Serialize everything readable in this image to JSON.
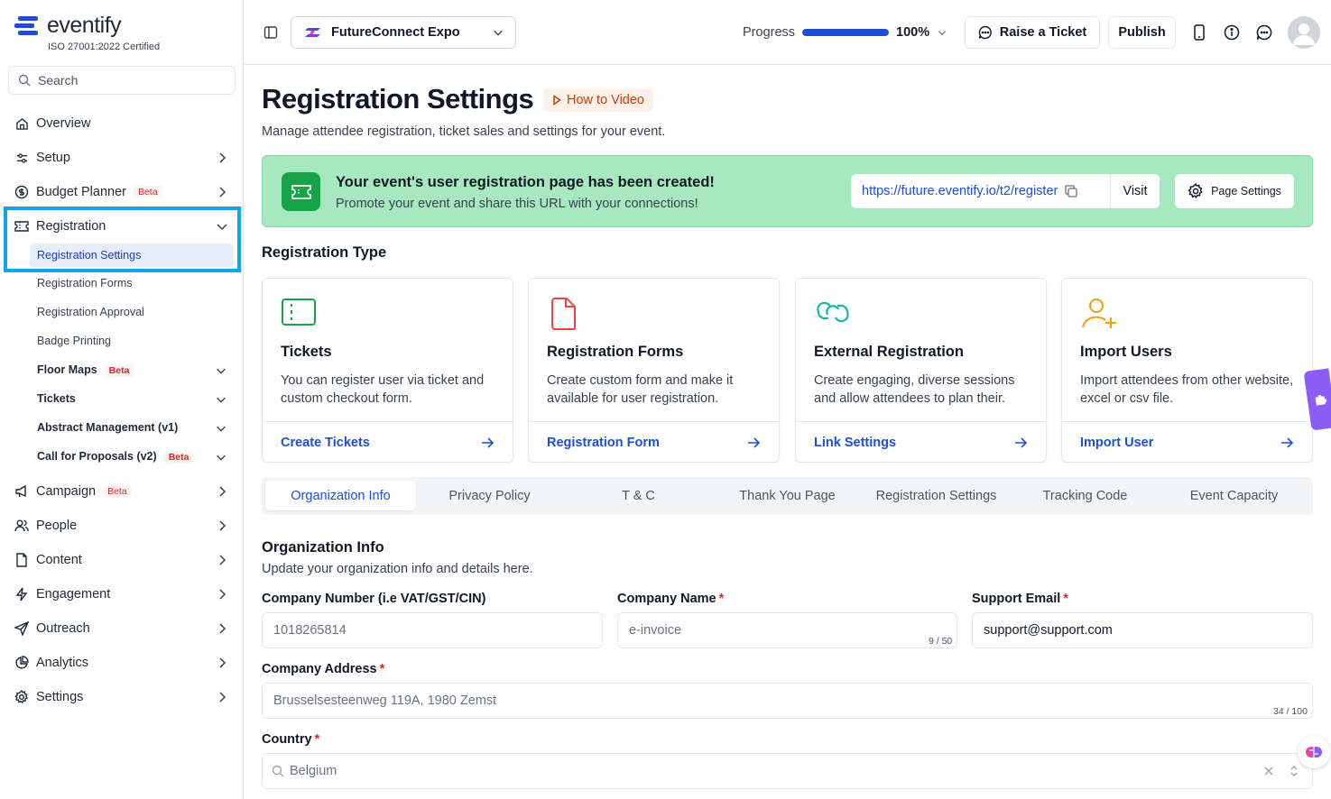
{
  "brand": {
    "name": "eventify",
    "cert": "ISO 27001:2022 Certified",
    "color": "#1d4ed8"
  },
  "sidebar": {
    "search_placeholder": "Search",
    "items": [
      {
        "label": "Overview"
      },
      {
        "label": "Setup"
      },
      {
        "label": "Budget Planner",
        "badge": "Beta"
      },
      {
        "label": "Registration"
      },
      {
        "label": "Campaign",
        "badge": "Beta"
      },
      {
        "label": "People"
      },
      {
        "label": "Content"
      },
      {
        "label": "Engagement"
      },
      {
        "label": "Outreach"
      },
      {
        "label": "Analytics"
      },
      {
        "label": "Settings"
      }
    ],
    "registration_sub": [
      {
        "label": "Registration Settings"
      },
      {
        "label": "Registration Forms"
      },
      {
        "label": "Registration Approval"
      },
      {
        "label": "Badge Printing"
      },
      {
        "label": "Floor Maps",
        "badge": "Beta"
      },
      {
        "label": "Tickets"
      },
      {
        "label": "Abstract Management (v1)"
      },
      {
        "label": "Call for Proposals (v2)",
        "badge": "Beta"
      }
    ]
  },
  "topbar": {
    "event_name": "FutureConnect Expo",
    "progress_label": "Progress",
    "progress_value": "100%",
    "progress_fraction": 1.0,
    "raise_ticket": "Raise a Ticket",
    "publish": "Publish"
  },
  "page": {
    "title": "Registration Settings",
    "how_to": "How to Video",
    "subtitle": "Manage attendee registration, ticket sales and settings for your event."
  },
  "banner": {
    "title": "Your event's user registration page has been created!",
    "subtitle": "Promote your event and share this URL with your connections!",
    "url": "https://future.eventify.io/t2/register",
    "visit": "Visit",
    "page_settings": "Page Settings"
  },
  "registration_type": {
    "title": "Registration Type",
    "cards": [
      {
        "title": "Tickets",
        "desc": "You can register user via ticket and custom checkout form.",
        "link": "Create Tickets"
      },
      {
        "title": "Registration Forms",
        "desc": "Create custom form and make it available for user registration.",
        "link": "Registration Form"
      },
      {
        "title": "External Registration",
        "desc": "Create engaging, diverse sessions and allow attendees to plan their.",
        "link": "Link Settings"
      },
      {
        "title": "Import Users",
        "desc": "Import attendees from other website, excel or csv file.",
        "link": "Import User"
      }
    ]
  },
  "tabs": [
    {
      "label": "Organization Info"
    },
    {
      "label": "Privacy Policy"
    },
    {
      "label": "T & C"
    },
    {
      "label": "Thank You Page"
    },
    {
      "label": "Registration Settings"
    },
    {
      "label": "Tracking Code"
    },
    {
      "label": "Event Capacity"
    }
  ],
  "org_form": {
    "title": "Organization Info",
    "subtitle": "Update your organization info and details here.",
    "company_number": {
      "label": "Company Number (i.e VAT/GST/CIN)",
      "placeholder": "1018265814"
    },
    "company_name": {
      "label": "Company Name",
      "placeholder": "e-invoice",
      "counter": "9 / 50"
    },
    "support_email": {
      "label": "Support Email",
      "value": "support@support.com"
    },
    "company_address": {
      "label": "Company Address",
      "placeholder": "Brusselsesteenweg 119A, 1980 Zemst",
      "counter": "34 / 100"
    },
    "country": {
      "label": "Country",
      "placeholder": "Belgium"
    },
    "required_mark": "*"
  }
}
